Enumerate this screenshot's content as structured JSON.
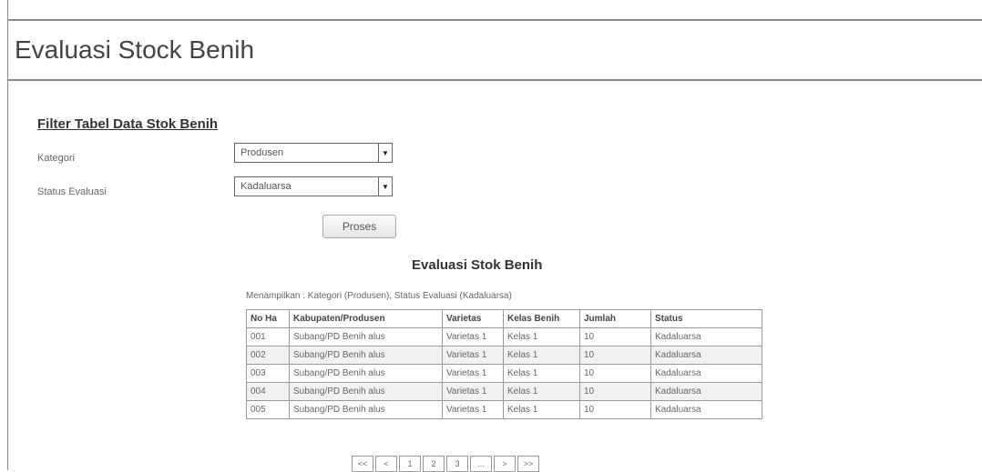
{
  "page": {
    "title": "Evaluasi Stock Benih"
  },
  "filter": {
    "title": "Filter Tabel Data Stok Benih",
    "kategori_label": "Kategori",
    "kategori_value": "Produsen",
    "status_label": "Status Evaluasi",
    "status_value": "Kadaluarsa",
    "submit_label": "Proses"
  },
  "results": {
    "title": "Evaluasi Stok Benih",
    "subtitle": "Menampilkan : Kategori (Produsen), Status Evaluasi (Kadaluarsa)",
    "columns": [
      "No Ha",
      "Kabupaten/Produsen",
      "Varietas",
      "Kelas Benih",
      "Jumlah",
      "Status"
    ],
    "rows": [
      [
        "001",
        "Subang/PD Benih alus",
        "Varietas 1",
        "Kelas 1",
        "10",
        "Kadaluarsa"
      ],
      [
        "002",
        "Subang/PD Benih alus",
        "Varietas 1",
        "Kelas 1",
        "10",
        "Kadaluarsa"
      ],
      [
        "003",
        "Subang/PD Benih alus",
        "Varietas 1",
        "Kelas 1",
        "10",
        "Kadaluarsa"
      ],
      [
        "004",
        "Subang/PD Benih alus",
        "Varietas 1",
        "Kelas 1",
        "10",
        "Kadaluarsa"
      ],
      [
        "005",
        "Subang/PD Benih alus",
        "Varietas 1",
        "Kelas 1",
        "10",
        "Kadaluarsa"
      ]
    ]
  },
  "pagination": {
    "first": "<<",
    "prev": "<",
    "p1": "1",
    "p2": "2",
    "p3": "3",
    "ellipsis": "...",
    "next": ">",
    "last": ">>"
  },
  "icons": {
    "dropdown": "chevron-down-icon"
  }
}
